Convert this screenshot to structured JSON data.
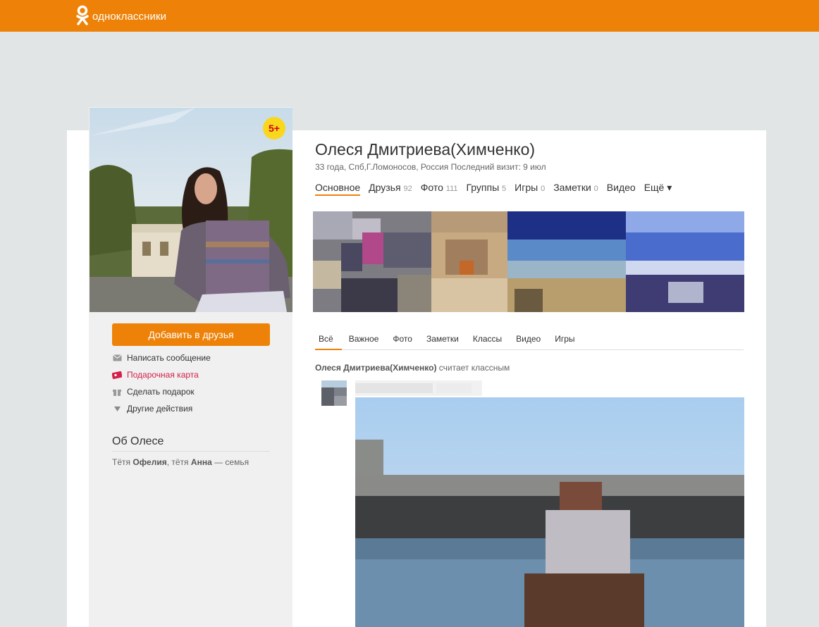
{
  "header": {
    "logo_icon": "ok-logo-icon",
    "logo_text": "одноклассники",
    "brand_color": "#ee8208"
  },
  "profile": {
    "badge": "5+",
    "add_friend_label": "Добавить в друзья",
    "actions": [
      {
        "label": "Написать сообщение",
        "icon": "envelope-icon"
      },
      {
        "label": "Подарочная карта",
        "icon": "gift-card-icon"
      },
      {
        "label": "Сделать подарок",
        "icon": "gift-icon"
      },
      {
        "label": "Другие действия",
        "icon": "triangle-down-icon"
      }
    ],
    "about_title": "Об Олесе",
    "about": {
      "relation1": "Тётя",
      "name1": "Офелия",
      "sep": ",",
      "relation2": "тётя",
      "name2": "Анна",
      "tail": "— семья"
    },
    "name": "Олеся Дмитриева(Химченко)",
    "meta": "33 года, Спб,Г.Ломоносов, Россия  Последний визит: 9 июл"
  },
  "nav": [
    {
      "label": "Основное",
      "count": ""
    },
    {
      "label": "Друзья",
      "count": "92"
    },
    {
      "label": "Фото",
      "count": "111"
    },
    {
      "label": "Группы",
      "count": "5"
    },
    {
      "label": "Игры",
      "count": "0"
    },
    {
      "label": "Заметки",
      "count": "0"
    },
    {
      "label": "Видео",
      "count": ""
    },
    {
      "label": "Ещё ▾",
      "count": ""
    }
  ],
  "feed_tabs": [
    "Всё",
    "Важное",
    "Фото",
    "Заметки",
    "Классы",
    "Видео",
    "Игры"
  ],
  "feed": {
    "author": "Олеся Дмитриева(Химченко)",
    "action": "считает классным"
  }
}
